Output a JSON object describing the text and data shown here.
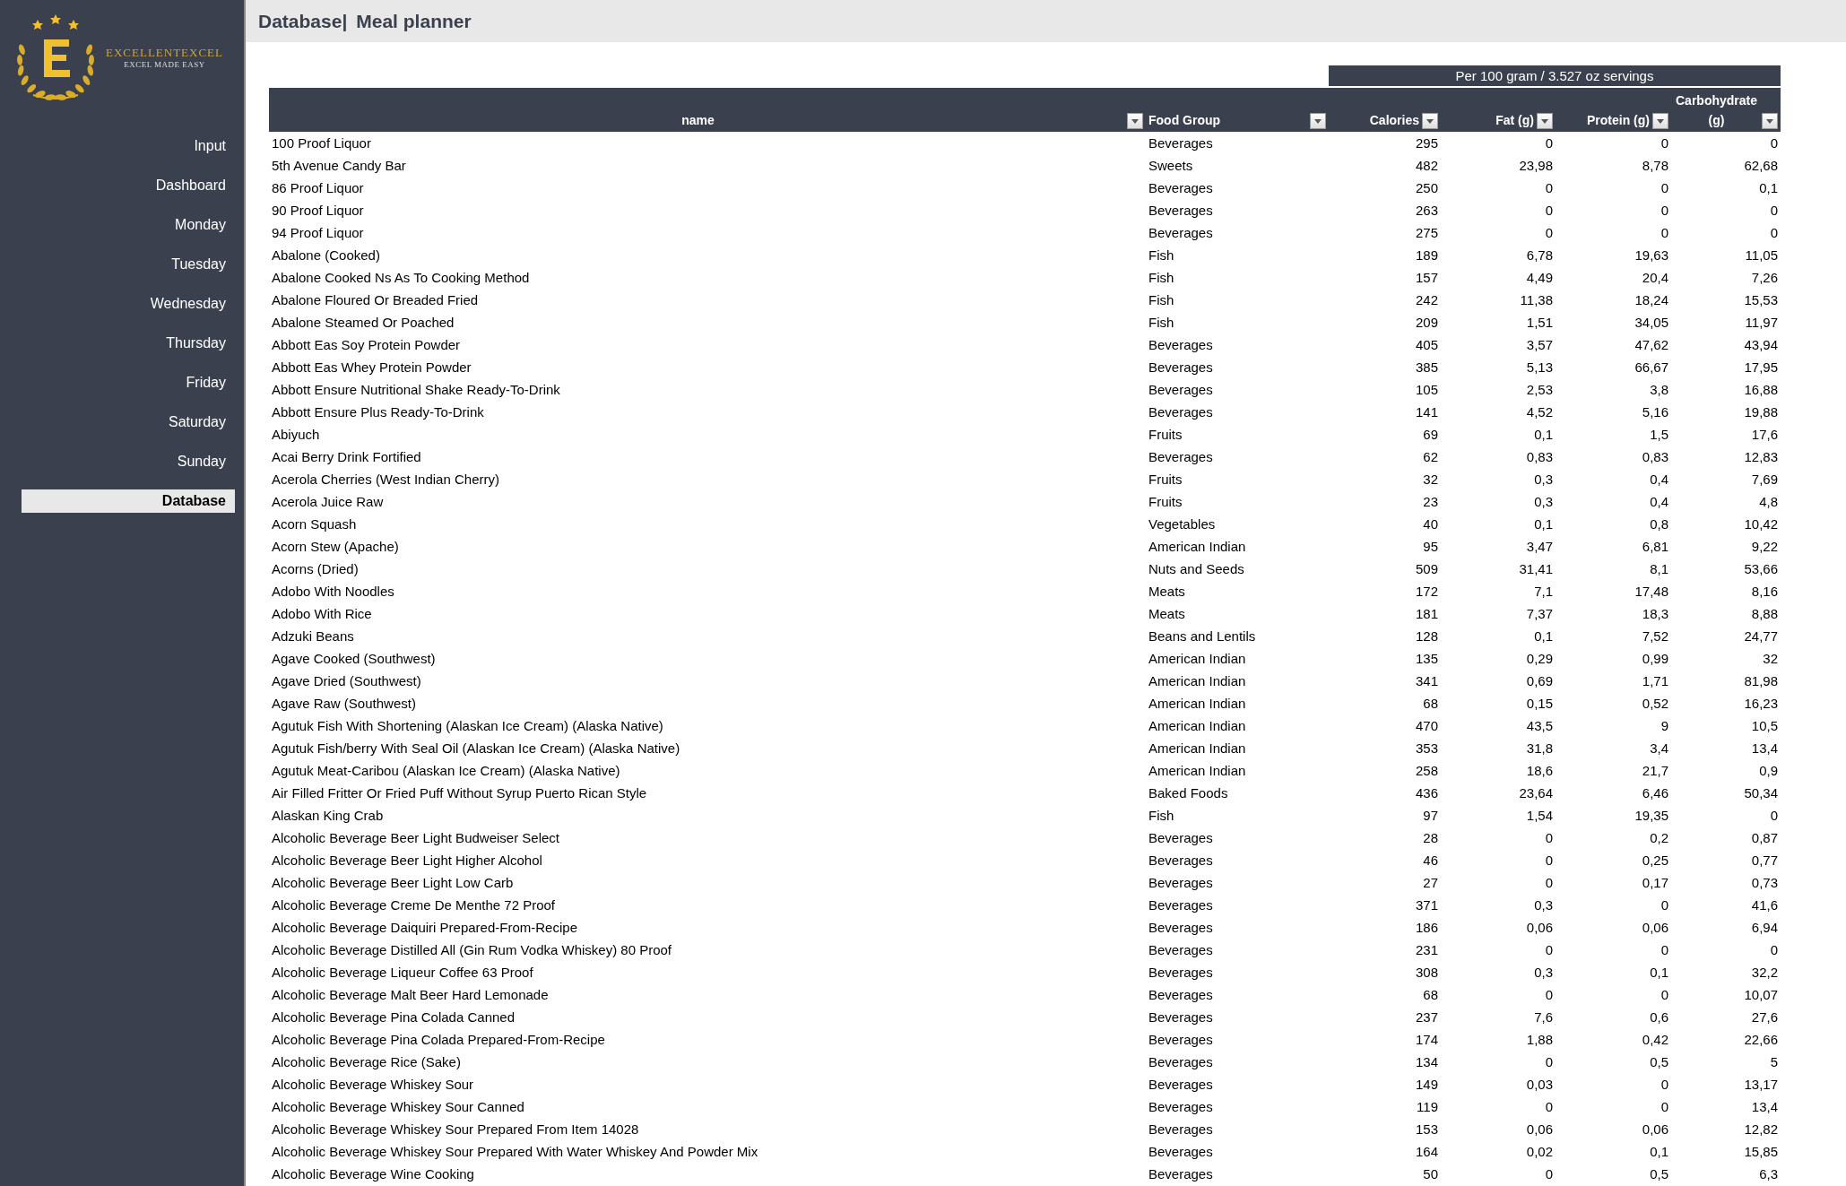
{
  "logo": {
    "brand": "EXCELLENTEXCEL",
    "tagline": "EXCEL MADE EASY"
  },
  "sidebar": {
    "items": [
      {
        "label": "Input",
        "selected": false
      },
      {
        "label": "Dashboard",
        "selected": false
      },
      {
        "label": "Monday",
        "selected": false
      },
      {
        "label": "Tuesday",
        "selected": false
      },
      {
        "label": "Wednesday",
        "selected": false
      },
      {
        "label": "Thursday",
        "selected": false
      },
      {
        "label": "Friday",
        "selected": false
      },
      {
        "label": "Saturday",
        "selected": false
      },
      {
        "label": "Sunday",
        "selected": false
      },
      {
        "label": "Database",
        "selected": true
      }
    ]
  },
  "header": {
    "section": "Database|",
    "title": "Meal planner"
  },
  "table": {
    "band": "Per 100 gram / 3.527 oz servings",
    "columns": [
      "name",
      "Food Group",
      "Calories",
      "Fat (g)",
      "Protein (g)",
      "Carbohydrate (g)"
    ],
    "rows": [
      [
        "100 Proof Liquor",
        "Beverages",
        "295",
        "0",
        "0",
        "0"
      ],
      [
        "5th Avenue Candy Bar",
        "Sweets",
        "482",
        "23,98",
        "8,78",
        "62,68"
      ],
      [
        "86 Proof Liquor",
        "Beverages",
        "250",
        "0",
        "0",
        "0,1"
      ],
      [
        "90 Proof Liquor",
        "Beverages",
        "263",
        "0",
        "0",
        "0"
      ],
      [
        "94 Proof Liquor",
        "Beverages",
        "275",
        "0",
        "0",
        "0"
      ],
      [
        "Abalone (Cooked)",
        "Fish",
        "189",
        "6,78",
        "19,63",
        "11,05"
      ],
      [
        "Abalone Cooked Ns As To Cooking Method",
        "Fish",
        "157",
        "4,49",
        "20,4",
        "7,26"
      ],
      [
        "Abalone Floured Or Breaded Fried",
        "Fish",
        "242",
        "11,38",
        "18,24",
        "15,53"
      ],
      [
        "Abalone Steamed Or Poached",
        "Fish",
        "209",
        "1,51",
        "34,05",
        "11,97"
      ],
      [
        "Abbott Eas Soy Protein Powder",
        "Beverages",
        "405",
        "3,57",
        "47,62",
        "43,94"
      ],
      [
        "Abbott Eas Whey Protein Powder",
        "Beverages",
        "385",
        "5,13",
        "66,67",
        "17,95"
      ],
      [
        "Abbott Ensure Nutritional Shake Ready-To-Drink",
        "Beverages",
        "105",
        "2,53",
        "3,8",
        "16,88"
      ],
      [
        "Abbott Ensure Plus Ready-To-Drink",
        "Beverages",
        "141",
        "4,52",
        "5,16",
        "19,88"
      ],
      [
        "Abiyuch",
        "Fruits",
        "69",
        "0,1",
        "1,5",
        "17,6"
      ],
      [
        "Acai Berry Drink Fortified",
        "Beverages",
        "62",
        "0,83",
        "0,83",
        "12,83"
      ],
      [
        "Acerola Cherries (West Indian Cherry)",
        "Fruits",
        "32",
        "0,3",
        "0,4",
        "7,69"
      ],
      [
        "Acerola Juice Raw",
        "Fruits",
        "23",
        "0,3",
        "0,4",
        "4,8"
      ],
      [
        "Acorn Squash",
        "Vegetables",
        "40",
        "0,1",
        "0,8",
        "10,42"
      ],
      [
        "Acorn Stew (Apache)",
        "American Indian",
        "95",
        "3,47",
        "6,81",
        "9,22"
      ],
      [
        "Acorns (Dried)",
        "Nuts and Seeds",
        "509",
        "31,41",
        "8,1",
        "53,66"
      ],
      [
        "Adobo With Noodles",
        "Meats",
        "172",
        "7,1",
        "17,48",
        "8,16"
      ],
      [
        "Adobo With Rice",
        "Meats",
        "181",
        "7,37",
        "18,3",
        "8,88"
      ],
      [
        "Adzuki Beans",
        "Beans and Lentils",
        "128",
        "0,1",
        "7,52",
        "24,77"
      ],
      [
        "Agave Cooked (Southwest)",
        "American Indian",
        "135",
        "0,29",
        "0,99",
        "32"
      ],
      [
        "Agave Dried (Southwest)",
        "American Indian",
        "341",
        "0,69",
        "1,71",
        "81,98"
      ],
      [
        "Agave Raw (Southwest)",
        "American Indian",
        "68",
        "0,15",
        "0,52",
        "16,23"
      ],
      [
        "Agutuk Fish With Shortening (Alaskan Ice Cream) (Alaska Native)",
        "American Indian",
        "470",
        "43,5",
        "9",
        "10,5"
      ],
      [
        "Agutuk Fish/berry With Seal Oil (Alaskan Ice Cream) (Alaska Native)",
        "American Indian",
        "353",
        "31,8",
        "3,4",
        "13,4"
      ],
      [
        "Agutuk Meat-Caribou (Alaskan Ice Cream) (Alaska Native)",
        "American Indian",
        "258",
        "18,6",
        "21,7",
        "0,9"
      ],
      [
        "Air Filled Fritter Or Fried Puff Without Syrup Puerto Rican Style",
        "Baked Foods",
        "436",
        "23,64",
        "6,46",
        "50,34"
      ],
      [
        "Alaskan King Crab",
        "Fish",
        "97",
        "1,54",
        "19,35",
        "0"
      ],
      [
        "Alcoholic Beverage Beer Light Budweiser Select",
        "Beverages",
        "28",
        "0",
        "0,2",
        "0,87"
      ],
      [
        "Alcoholic Beverage Beer Light Higher Alcohol",
        "Beverages",
        "46",
        "0",
        "0,25",
        "0,77"
      ],
      [
        "Alcoholic Beverage Beer Light Low Carb",
        "Beverages",
        "27",
        "0",
        "0,17",
        "0,73"
      ],
      [
        "Alcoholic Beverage Creme De Menthe 72 Proof",
        "Beverages",
        "371",
        "0,3",
        "0",
        "41,6"
      ],
      [
        "Alcoholic Beverage Daiquiri Prepared-From-Recipe",
        "Beverages",
        "186",
        "0,06",
        "0,06",
        "6,94"
      ],
      [
        "Alcoholic Beverage Distilled All (Gin Rum Vodka Whiskey) 80 Proof",
        "Beverages",
        "231",
        "0",
        "0",
        "0"
      ],
      [
        "Alcoholic Beverage Liqueur Coffee 63 Proof",
        "Beverages",
        "308",
        "0,3",
        "0,1",
        "32,2"
      ],
      [
        "Alcoholic Beverage Malt Beer Hard Lemonade",
        "Beverages",
        "68",
        "0",
        "0",
        "10,07"
      ],
      [
        "Alcoholic Beverage Pina Colada Canned",
        "Beverages",
        "237",
        "7,6",
        "0,6",
        "27,6"
      ],
      [
        "Alcoholic Beverage Pina Colada Prepared-From-Recipe",
        "Beverages",
        "174",
        "1,88",
        "0,42",
        "22,66"
      ],
      [
        "Alcoholic Beverage Rice (Sake)",
        "Beverages",
        "134",
        "0",
        "0,5",
        "5"
      ],
      [
        "Alcoholic Beverage Whiskey Sour",
        "Beverages",
        "149",
        "0,03",
        "0",
        "13,17"
      ],
      [
        "Alcoholic Beverage Whiskey Sour Canned",
        "Beverages",
        "119",
        "0",
        "0",
        "13,4"
      ],
      [
        "Alcoholic Beverage Whiskey Sour Prepared From Item 14028",
        "Beverages",
        "153",
        "0,06",
        "0,06",
        "12,82"
      ],
      [
        "Alcoholic Beverage Whiskey Sour Prepared With Water Whiskey And Powder Mix",
        "Beverages",
        "164",
        "0,02",
        "0,1",
        "15,85"
      ],
      [
        "Alcoholic Beverage Wine Cooking",
        "Beverages",
        "50",
        "0",
        "0,5",
        "6,3"
      ]
    ]
  }
}
